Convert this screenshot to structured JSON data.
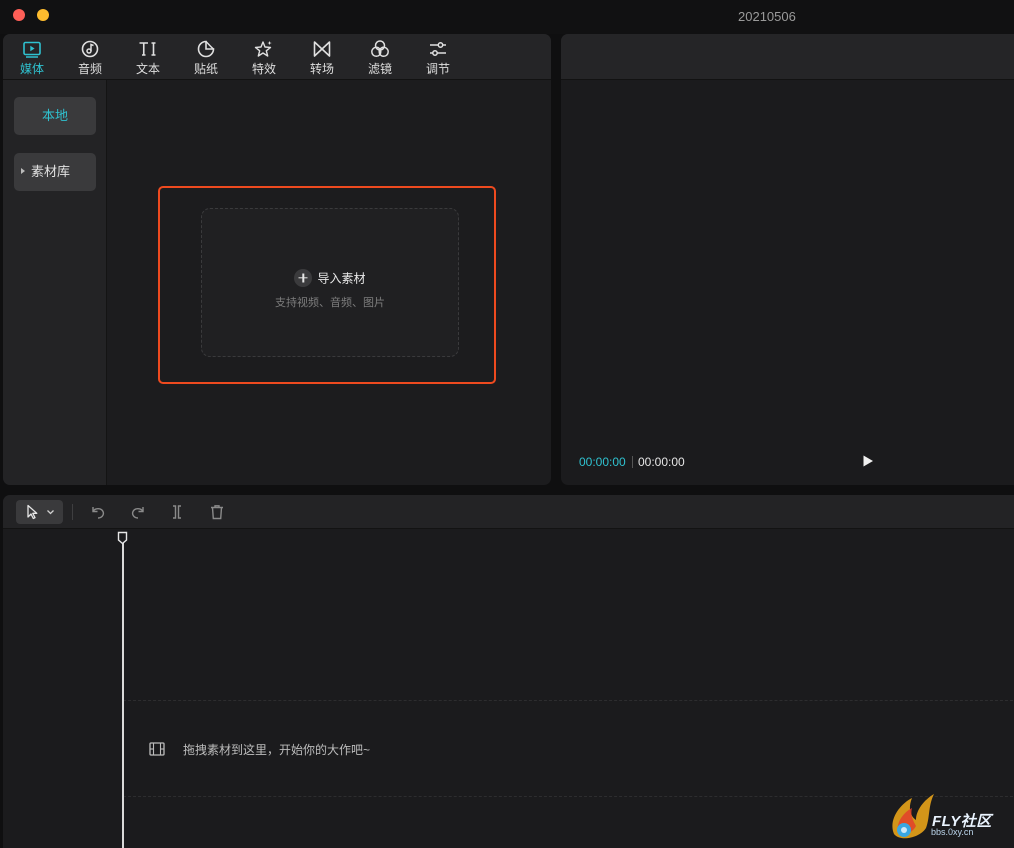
{
  "window": {
    "title": "20210506"
  },
  "toolbar": {
    "tools": [
      {
        "label": "媒体",
        "icon": "media-icon",
        "active": true
      },
      {
        "label": "音频",
        "icon": "audio-icon"
      },
      {
        "label": "文本",
        "icon": "text-icon"
      },
      {
        "label": "贴纸",
        "icon": "sticker-icon"
      },
      {
        "label": "特效",
        "icon": "effects-icon"
      },
      {
        "label": "转场",
        "icon": "transition-icon"
      },
      {
        "label": "滤镜",
        "icon": "filter-icon"
      },
      {
        "label": "调节",
        "icon": "adjust-icon"
      }
    ]
  },
  "sidebar": {
    "local": "本地",
    "library": "素材库"
  },
  "dropzone": {
    "import_label": "导入素材",
    "hint": "支持视频、音频、图片"
  },
  "preview": {
    "current_time": "00:00:00",
    "total_time": "00:00:00"
  },
  "timeline": {
    "hint": "拖拽素材到这里，开始你的大作吧~"
  },
  "watermark": {
    "brand": "FLY社区",
    "site": "bbs.0xy.cn"
  },
  "colors": {
    "accent": "#2fc2d0",
    "highlight": "#ee4a1f"
  }
}
